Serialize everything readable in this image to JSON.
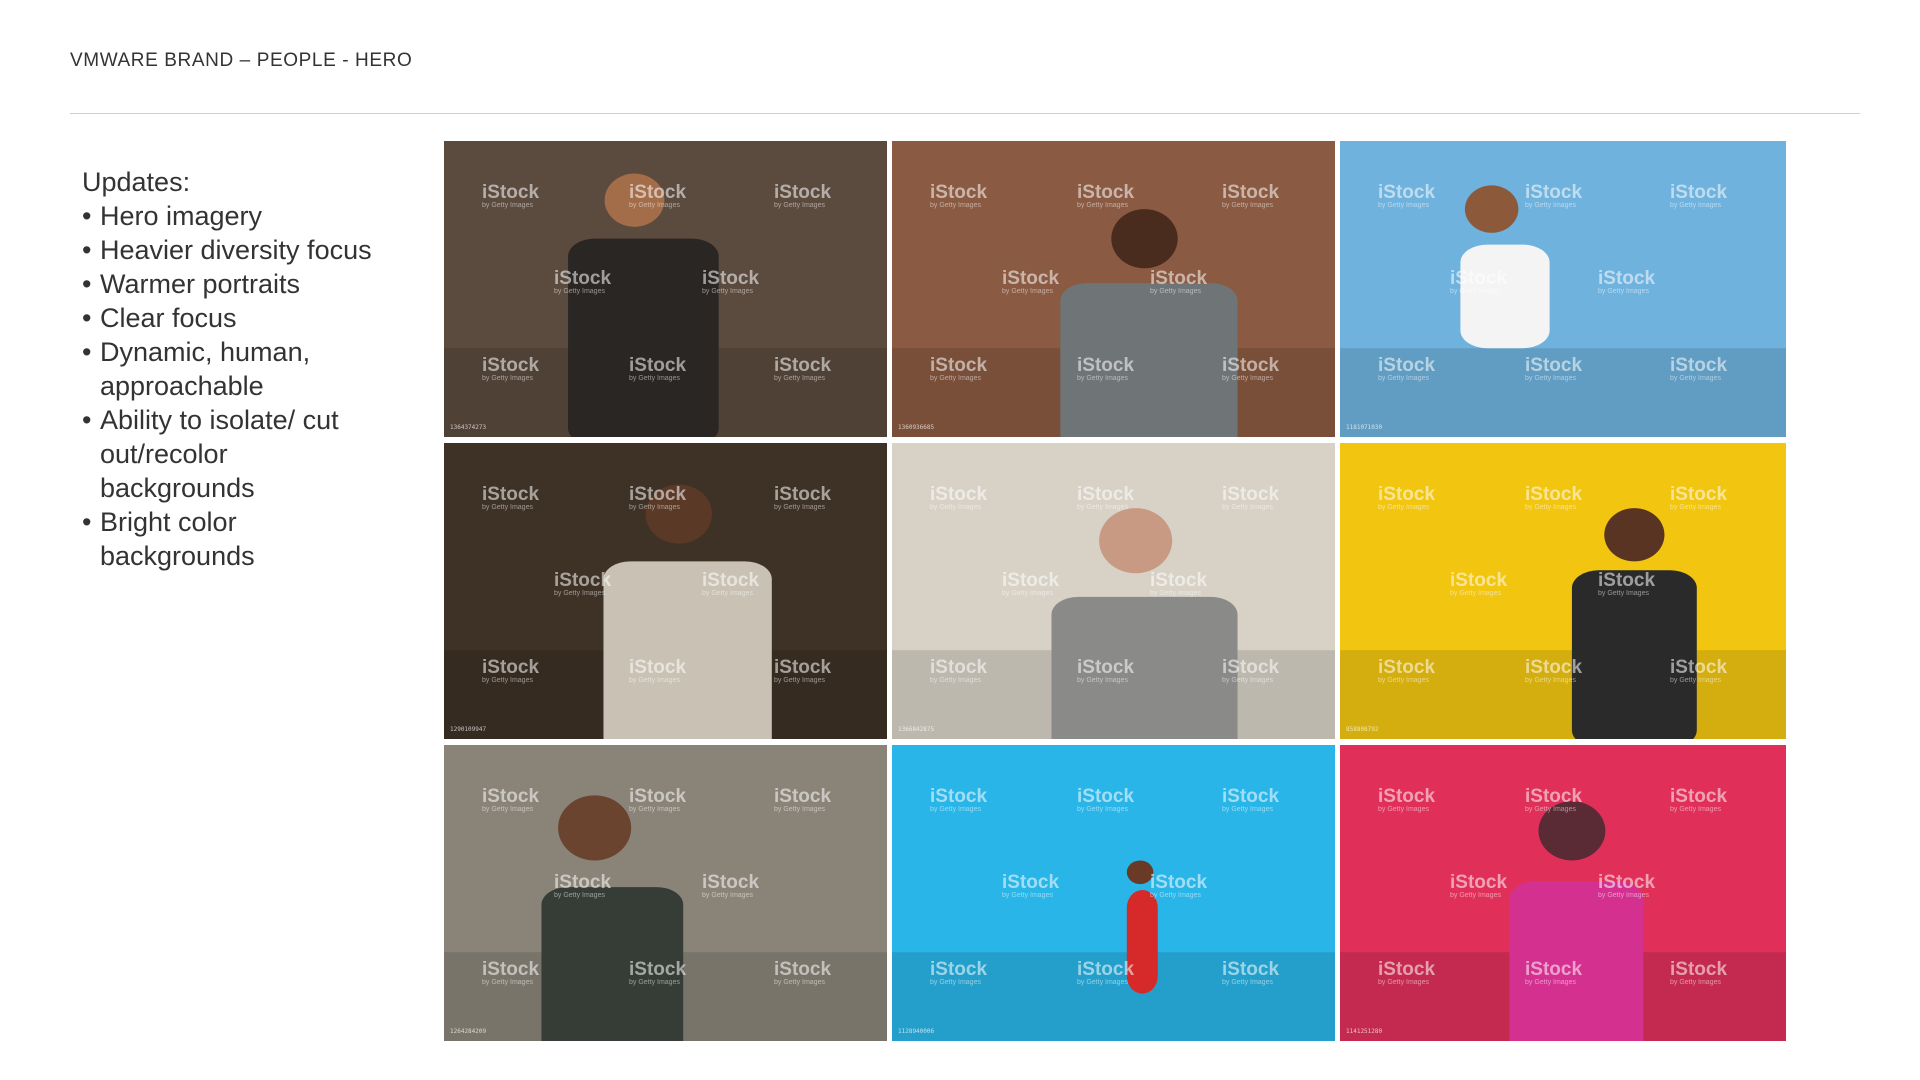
{
  "header": {
    "title": "VMWARE BRAND – PEOPLE - HERO"
  },
  "notes": {
    "title": "Updates:",
    "items": [
      "Hero imagery",
      "Heavier diversity focus",
      "Warmer portraits",
      "Clear focus",
      "Dynamic, human, approachable",
      "Ability to isolate/ cut out/recolor backgrounds",
      "Bright color backgrounds"
    ]
  },
  "watermark": {
    "brand": "iStock",
    "sub": "by Getty Images"
  },
  "photos": [
    {
      "name": "photo-woman-office-laughing",
      "id": "1364374273",
      "bg": "#5b4a3e",
      "accent": "#2a2624",
      "skin": "#a46d4a"
    },
    {
      "name": "photo-man-with-tablet",
      "id": "1360936685",
      "bg": "#8a5a43",
      "accent": "#6f7476",
      "skin": "#4a2c1f"
    },
    {
      "name": "photo-man-with-laptop-blue",
      "id": "1181071030",
      "bg": "#6fb2dd",
      "accent": "#f4f4f4",
      "skin": "#8c5a3b"
    },
    {
      "name": "photo-man-cardigan-smiling",
      "id": "1290109947",
      "bg": "#3e3126",
      "accent": "#c9c1b3",
      "skin": "#5a3a27"
    },
    {
      "name": "photo-senior-woman-smiling",
      "id": "1366842875",
      "bg": "#d8d2c6",
      "accent": "#8a8a88",
      "skin": "#c99a83"
    },
    {
      "name": "photo-man-yellow-wall",
      "id": "858808792",
      "bg": "#f2c511",
      "accent": "#2a2a2a",
      "skin": "#5a3422"
    },
    {
      "name": "photo-man-glasses-headphones",
      "id": "1264284209",
      "bg": "#8a8478",
      "accent": "#363c36",
      "skin": "#6a442f"
    },
    {
      "name": "photo-woman-walking-blue",
      "id": "1128940006",
      "bg": "#2ab5e8",
      "accent": "#d62a2a",
      "skin": "#6a3a26"
    },
    {
      "name": "photo-woman-neon-pink",
      "id": "1141251280",
      "bg": "#e0305a",
      "accent": "#d43090",
      "skin": "#5a2a35"
    }
  ]
}
